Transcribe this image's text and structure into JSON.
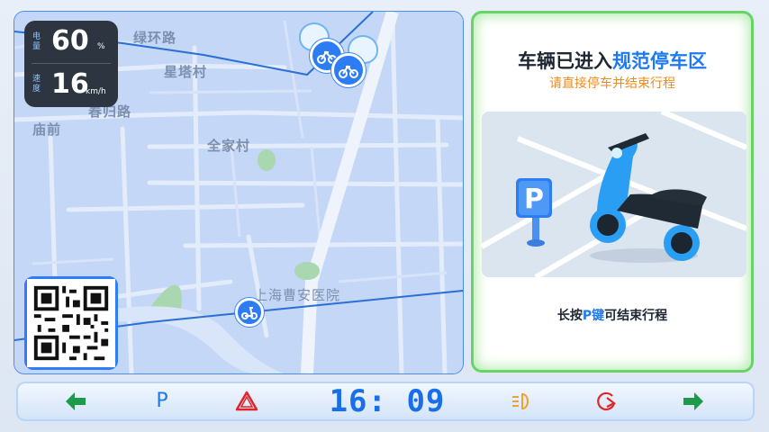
{
  "hud": {
    "battery_label": "电量",
    "battery_value": "60",
    "battery_unit": "%",
    "speed_label": "速度",
    "speed_value": "16",
    "speed_unit": "km/h"
  },
  "map": {
    "labels": {
      "road_lvhuan": "绿环路",
      "xingta": "星塔村",
      "chungui": "春归路",
      "miaoqian": "庙前",
      "quanjia": "全家村",
      "hospital": "上海曹安医院"
    }
  },
  "notice": {
    "title_prefix": "车辆已进入",
    "title_highlight": "规范停车区",
    "subtitle": "请直接停车并结束行程",
    "foot_prefix": "长按",
    "foot_highlight": "P键",
    "foot_suffix": "可结束行程"
  },
  "status_bar": {
    "left_arrow_icon": "arrow-left-icon",
    "parking_glyph": "P",
    "hazard_icon": "hazard-triangle-icon",
    "time": "16: 09",
    "headlight_icon": "headlight-icon",
    "ready_icon": "ready-power-icon",
    "right_arrow_icon": "arrow-right-icon",
    "colors": {
      "arrow": "#1f9a4b",
      "parking": "#1e7af0",
      "hazard": "#e0242a",
      "clock": "#1a6fe8",
      "headlight": "#f3a12a",
      "ready": "#e0242a"
    }
  }
}
